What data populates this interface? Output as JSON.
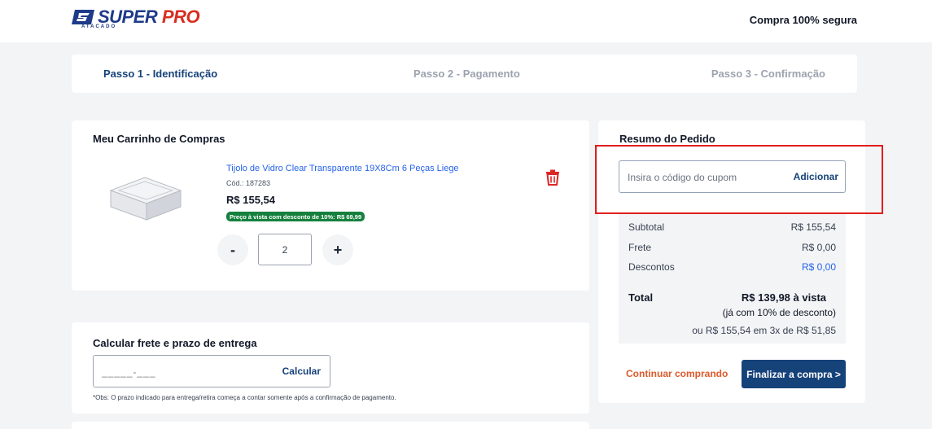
{
  "header": {
    "logo_word1": "SUPER",
    "logo_word2": "PRO",
    "logo_sub": "ATACADO",
    "secure_label": "Compra 100% segura"
  },
  "steps": [
    {
      "label": "Passo 1 - Identificação",
      "active": true
    },
    {
      "label": "Passo 2 - Pagamento",
      "active": false
    },
    {
      "label": "Passo 3 - Confirmação",
      "active": false
    }
  ],
  "cart": {
    "title": "Meu Carrinho de Compras",
    "item": {
      "name": "Tijolo de Vidro Clear Transparente 19X8Cm 6 Peças Liege",
      "code": "Cód.: 187283",
      "price": "R$ 155,54",
      "badge": "Preço à vista com desconto de 10%: R$ 69,99",
      "quantity": "2",
      "image_icon": "glass-brick-image"
    },
    "minus_label": "-",
    "plus_label": "+"
  },
  "frete": {
    "title": "Calcular frete e prazo de entrega",
    "cep_placeholder": "_____-___",
    "button_label": "Calcular",
    "note": "*Obs: O prazo indicado para entrega/retira começa a contar somente após a confirmação de pagamento."
  },
  "summary": {
    "title": "Resumo do Pedido",
    "coupon_placeholder": "Insira o código do cupom",
    "coupon_button": "Adicionar",
    "rows": [
      {
        "label": "Subtotal",
        "value": "R$ 155,54"
      },
      {
        "label": "Frete",
        "value": "R$ 0,00"
      },
      {
        "label": "Descontos",
        "value": "R$ 0,00"
      }
    ],
    "total_label": "Total",
    "total_value": "R$ 139,98 à vista",
    "total_discount_note": "(já com 10% de desconto)",
    "installments": "ou R$ 155,54 em 3x de R$ 51,85",
    "continue_label": "Continuar comprando",
    "checkout_label": "Finalizar a compra >"
  },
  "colors": {
    "brand_blue": "#16427a",
    "brand_red": "#d92d20",
    "link_blue": "#2563eb",
    "badge_green": "#15803d",
    "continue_orange": "#dc5a2b",
    "highlight_red": "#e11d1d"
  }
}
